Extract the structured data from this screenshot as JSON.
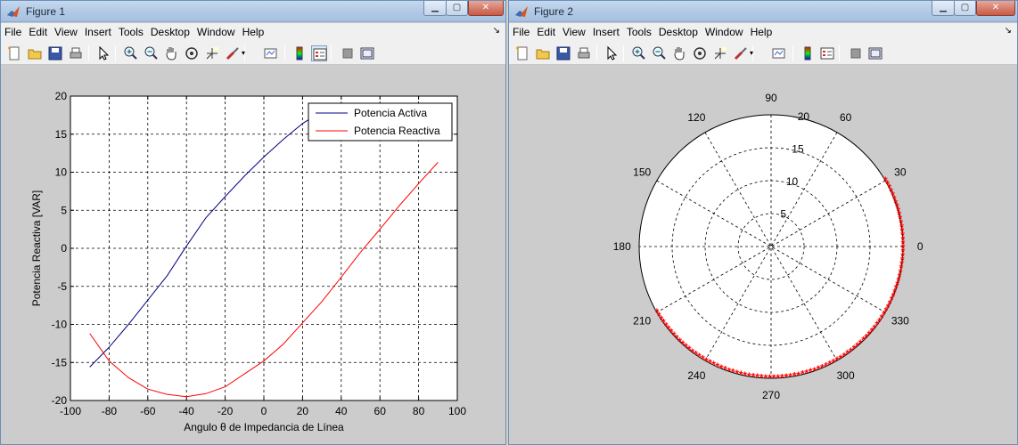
{
  "figure1": {
    "title": "Figure 1",
    "menu": [
      "File",
      "Edit",
      "View",
      "Insert",
      "Tools",
      "Desktop",
      "Window",
      "Help"
    ],
    "chart_data": {
      "type": "line",
      "xlabel": "Angulo θ de Impedancia de Línea",
      "ylabel": "Potencia Reactiva [VAR]",
      "xlim": [
        -100,
        100
      ],
      "ylim": [
        -20,
        20
      ],
      "xticks": [
        -100,
        -80,
        -60,
        -40,
        -20,
        0,
        20,
        40,
        60,
        80,
        100
      ],
      "yticks": [
        -20,
        -15,
        -10,
        -5,
        0,
        5,
        10,
        15,
        20
      ],
      "grid": true,
      "legend_position": "top-right",
      "series": [
        {
          "name": "Potencia Activa",
          "color": "#000080",
          "x": [
            -90,
            -80,
            -70,
            -60,
            -50,
            -40,
            -30,
            -20,
            -10,
            0,
            10,
            20,
            30
          ],
          "y": [
            -15.6,
            -13.0,
            -10.0,
            -6.8,
            -3.6,
            0.3,
            4.0,
            6.8,
            9.5,
            12.0,
            14.3,
            16.4,
            18.0
          ]
        },
        {
          "name": "Potencia Reactiva",
          "color": "#ff0000",
          "x": [
            -90,
            -80,
            -70,
            -60,
            -50,
            -40,
            -30,
            -20,
            -10,
            0,
            10,
            20,
            30,
            40,
            50,
            60,
            70,
            80,
            90
          ],
          "y": [
            -11.2,
            -14.8,
            -17.0,
            -18.5,
            -19.2,
            -19.5,
            -19.1,
            -18.2,
            -16.5,
            -14.8,
            -12.6,
            -9.8,
            -7.0,
            -3.8,
            -0.5,
            2.5,
            5.6,
            8.5,
            11.3
          ]
        }
      ]
    }
  },
  "figure2": {
    "title": "Figure 2",
    "menu": [
      "File",
      "Edit",
      "View",
      "Insert",
      "Tools",
      "Desktop",
      "Window",
      "Help"
    ],
    "chart_data": {
      "type": "scatter",
      "coordinate_system": "polar",
      "rmax": 20,
      "rticks": [
        5,
        10,
        15,
        20
      ],
      "angle_ticks": [
        0,
        30,
        60,
        90,
        120,
        150,
        180,
        210,
        240,
        270,
        300,
        330
      ],
      "grid": true,
      "marker": "*",
      "series": [
        {
          "color": "#ff0000",
          "theta_range": [
            -150,
            30
          ],
          "r": 20,
          "theta_step": 1.8
        }
      ]
    }
  },
  "toolbar_icons": [
    "new-figure-icon",
    "open-file-icon",
    "save-icon",
    "print-icon",
    "pointer-icon",
    "zoom-in-icon",
    "zoom-out-icon",
    "pan-hand-icon",
    "rotate-3d-icon",
    "data-cursor-icon",
    "brush-icon",
    "link-plot-icon",
    "colorbar-icon",
    "legend-icon",
    "hide-tools-icon",
    "show-tools-icon"
  ]
}
